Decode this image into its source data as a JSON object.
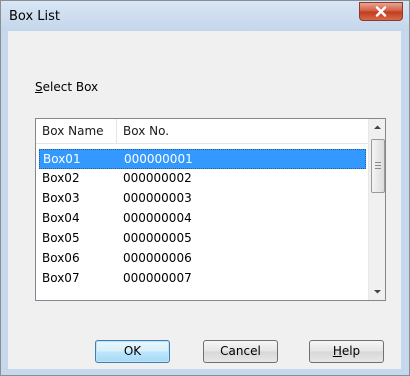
{
  "window": {
    "title": "Box List"
  },
  "select_label": {
    "mnemonic": "S",
    "rest": "elect Box"
  },
  "list": {
    "columns": [
      "Box Name",
      "Box No."
    ],
    "rows": [
      {
        "name": "Box01",
        "number": "000000001",
        "selected": true
      },
      {
        "name": "Box02",
        "number": "000000002",
        "selected": false
      },
      {
        "name": "Box03",
        "number": "000000003",
        "selected": false
      },
      {
        "name": "Box04",
        "number": "000000004",
        "selected": false
      },
      {
        "name": "Box05",
        "number": "000000005",
        "selected": false
      },
      {
        "name": "Box06",
        "number": "000000006",
        "selected": false
      },
      {
        "name": "Box07",
        "number": "000000007",
        "selected": false
      }
    ]
  },
  "buttons": {
    "ok": "OK",
    "cancel": "Cancel",
    "help_mnemonic": "H",
    "help_rest": "elp"
  },
  "colors": {
    "selection": "#3399ff",
    "close_button": "#c9462c"
  },
  "icons": {
    "close": "close-icon",
    "scroll_up": "chevron-up-icon",
    "scroll_down": "chevron-down-icon"
  }
}
